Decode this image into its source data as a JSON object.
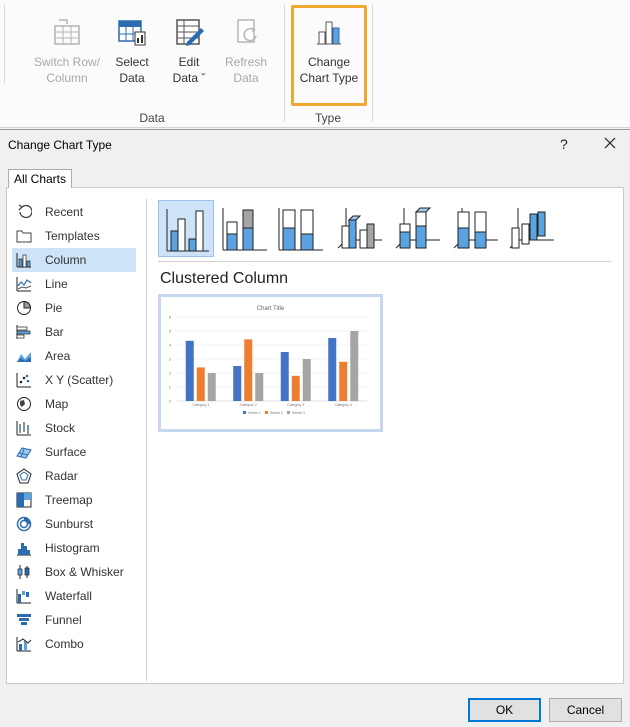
{
  "ribbon": {
    "switch_row_column": "Switch Row/\nColumn",
    "select_data": "Select\nData",
    "edit_data": "Edit\nData ˇ",
    "refresh_data": "Refresh\nData",
    "change_chart_type": "Change\nChart Type",
    "group_data": "Data",
    "group_type": "Type",
    "highlight_color": "#f0a830"
  },
  "dialog": {
    "title": "Change Chart Type",
    "help": "?",
    "tab_all_charts": "All Charts",
    "sidebar": [
      {
        "label": "Recent",
        "icon": "recent-icon"
      },
      {
        "label": "Templates",
        "icon": "folder-icon"
      },
      {
        "label": "Column",
        "icon": "column-chart-icon",
        "selected": true
      },
      {
        "label": "Line",
        "icon": "line-chart-icon"
      },
      {
        "label": "Pie",
        "icon": "pie-chart-icon"
      },
      {
        "label": "Bar",
        "icon": "bar-chart-icon"
      },
      {
        "label": "Area",
        "icon": "area-chart-icon"
      },
      {
        "label": "X Y (Scatter)",
        "icon": "scatter-chart-icon"
      },
      {
        "label": "Map",
        "icon": "map-chart-icon"
      },
      {
        "label": "Stock",
        "icon": "stock-chart-icon"
      },
      {
        "label": "Surface",
        "icon": "surface-chart-icon"
      },
      {
        "label": "Radar",
        "icon": "radar-chart-icon"
      },
      {
        "label": "Treemap",
        "icon": "treemap-chart-icon"
      },
      {
        "label": "Sunburst",
        "icon": "sunburst-chart-icon"
      },
      {
        "label": "Histogram",
        "icon": "histogram-chart-icon"
      },
      {
        "label": "Box & Whisker",
        "icon": "box-whisker-chart-icon"
      },
      {
        "label": "Waterfall",
        "icon": "waterfall-chart-icon"
      },
      {
        "label": "Funnel",
        "icon": "funnel-chart-icon"
      },
      {
        "label": "Combo",
        "icon": "combo-chart-icon"
      }
    ],
    "subtype_selected": "Clustered Column",
    "ok": "OK",
    "cancel": "Cancel"
  },
  "chart_data": {
    "type": "bar",
    "title": "Chart Title",
    "categories": [
      "Category 1",
      "Category 2",
      "Category 3",
      "Category 4"
    ],
    "series": [
      {
        "name": "Series 1",
        "values": [
          4.3,
          2.5,
          3.5,
          4.5
        ],
        "color": "#4472c4"
      },
      {
        "name": "Series 2",
        "values": [
          2.4,
          4.4,
          1.8,
          2.8
        ],
        "color": "#ed7d31"
      },
      {
        "name": "Series 3",
        "values": [
          2,
          2,
          3,
          5
        ],
        "color": "#a5a5a5"
      }
    ],
    "yticks": [
      "0",
      "1",
      "2",
      "3",
      "4",
      "5",
      "6"
    ],
    "ylim": [
      0,
      6
    ],
    "legend": "bottom",
    "grid": true
  }
}
